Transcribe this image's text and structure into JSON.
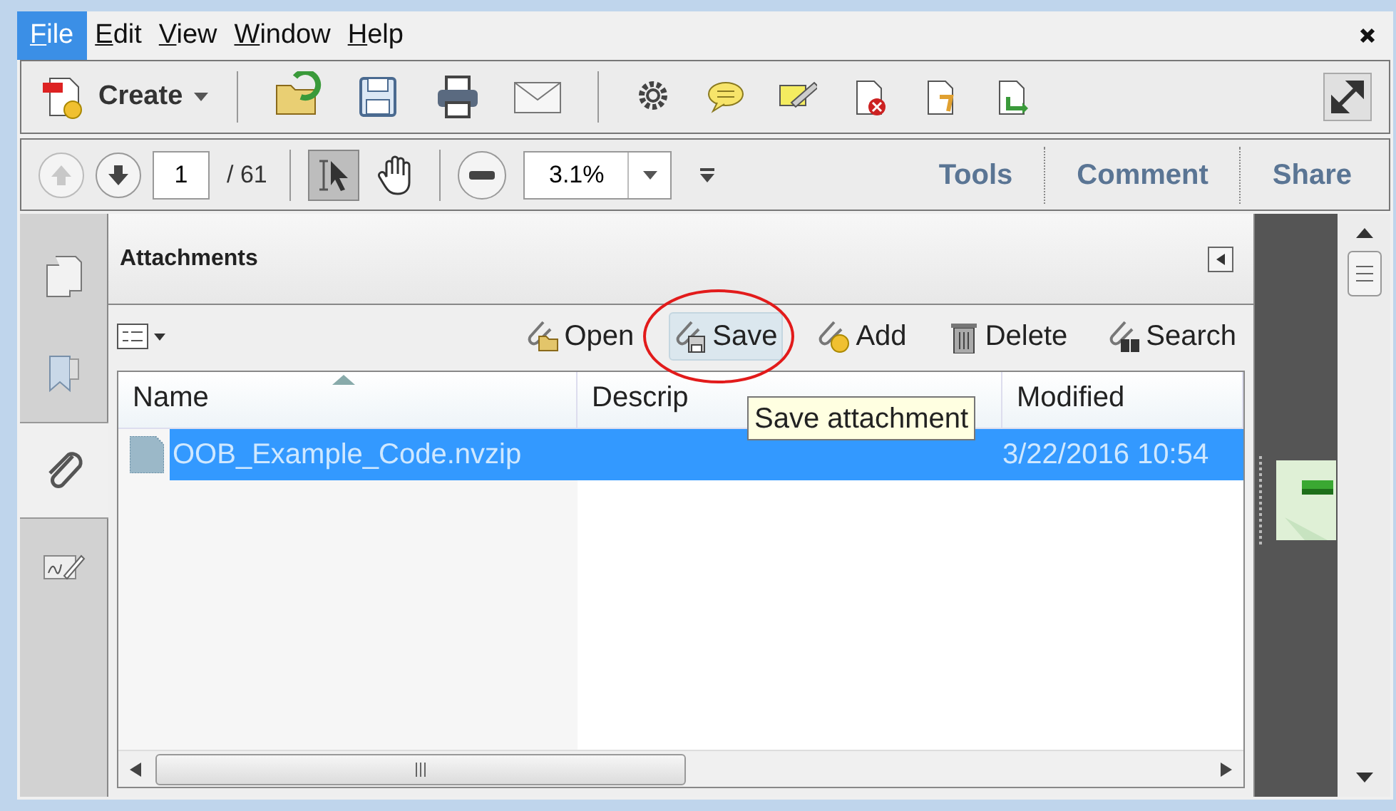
{
  "menu": [
    {
      "label": "File",
      "selected": true
    },
    {
      "label": "Edit",
      "selected": false
    },
    {
      "label": "View",
      "selected": false
    },
    {
      "label": "Window",
      "selected": false
    },
    {
      "label": "Help",
      "selected": false
    }
  ],
  "toolbar": {
    "create_label": "Create"
  },
  "navigation": {
    "page": "1",
    "page_total": "/ 61",
    "zoom": "3.1%",
    "panes": [
      {
        "label": "Tools"
      },
      {
        "label": "Comment"
      },
      {
        "label": "Share"
      }
    ]
  },
  "sidebar": {
    "items": [
      {
        "kind": "pages",
        "selected": false
      },
      {
        "kind": "bookmarks",
        "selected": false
      },
      {
        "kind": "attachments",
        "selected": true
      },
      {
        "kind": "signatures",
        "selected": false
      }
    ]
  },
  "attachments": {
    "title": "Attachments",
    "actions": [
      {
        "kind": "open",
        "label": "Open",
        "hovered": false
      },
      {
        "kind": "save",
        "label": "Save",
        "hovered": true
      },
      {
        "kind": "add",
        "label": "Add",
        "hovered": false
      },
      {
        "kind": "delete",
        "label": "Delete",
        "hovered": false
      },
      {
        "kind": "search",
        "label": "Search",
        "hovered": false
      }
    ],
    "columns": [
      {
        "label": "Name",
        "sorted": true
      },
      {
        "label": "Descrip",
        "sorted": false
      },
      {
        "label": "Modified",
        "sorted": false
      }
    ],
    "rows": [
      {
        "name": "OOB_Example_Code.nvzip",
        "modified": "3/22/2016 10:54",
        "selected": true
      }
    ],
    "tooltip": "Save attachment"
  }
}
